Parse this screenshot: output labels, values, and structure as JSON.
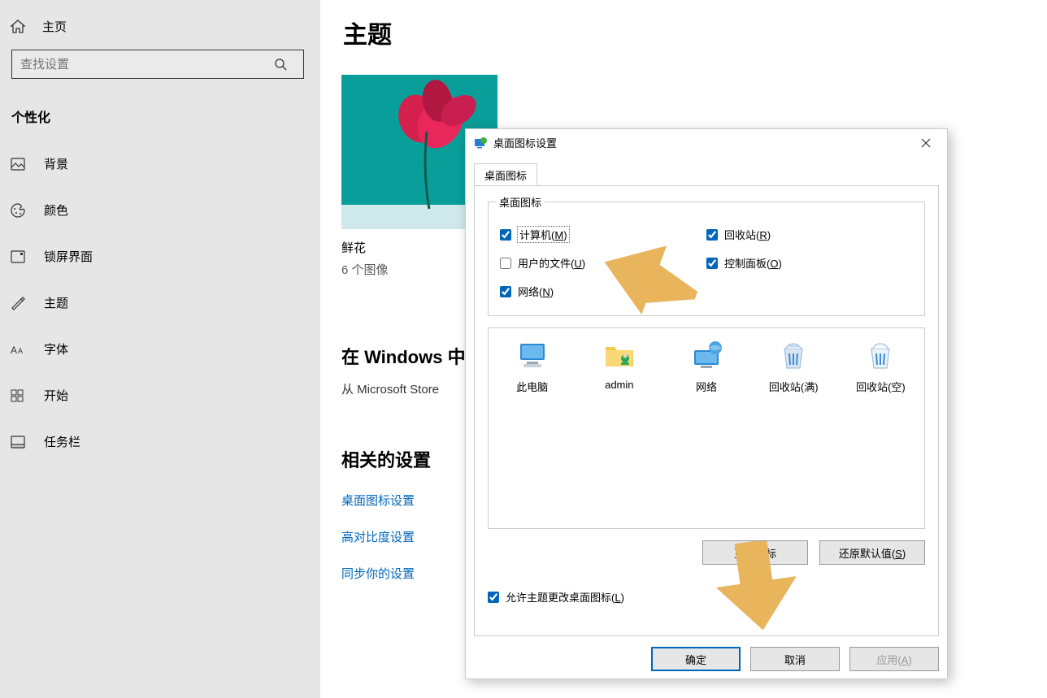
{
  "sidebar": {
    "home": "主页",
    "search_placeholder": "查找设置",
    "section": "个性化",
    "items": [
      {
        "label": "背景",
        "id": "background"
      },
      {
        "label": "颜色",
        "id": "colors"
      },
      {
        "label": "锁屏界面",
        "id": "lockscreen"
      },
      {
        "label": "主题",
        "id": "themes"
      },
      {
        "label": "字体",
        "id": "fonts"
      },
      {
        "label": "开始",
        "id": "start"
      },
      {
        "label": "任务栏",
        "id": "taskbar"
      }
    ]
  },
  "main": {
    "title": "主题",
    "theme_name": "鲜花",
    "theme_sub": "6 个图像",
    "store_head_prefix": "在 Windows 中",
    "store_sub_prefix": "从 Microsoft Store ",
    "related_head": "相关的设置",
    "links": [
      "桌面图标设置",
      "高对比度设置",
      "同步你的设置"
    ]
  },
  "dialog": {
    "title": "桌面图标设置",
    "tab": "桌面图标",
    "group_label": "桌面图标",
    "checks": {
      "computer": {
        "label": "计算机(",
        "shortcut": "M",
        "suffix": ")",
        "checked": true
      },
      "userfiles": {
        "label": "用户的文件(",
        "shortcut": "U",
        "suffix": ")",
        "checked": false
      },
      "network": {
        "label": "网络(",
        "shortcut": "N",
        "suffix": ")",
        "checked": true
      },
      "recycle": {
        "label": "回收站(",
        "shortcut": "R",
        "suffix": ")",
        "checked": true
      },
      "control": {
        "label": "控制面板(",
        "shortcut": "O",
        "suffix": ")",
        "checked": true
      }
    },
    "icons": [
      {
        "label": "此电脑",
        "kind": "pc"
      },
      {
        "label": "admin",
        "kind": "user"
      },
      {
        "label": "网络",
        "kind": "net"
      },
      {
        "label": "回收站(满)",
        "kind": "bin-full"
      },
      {
        "label": "回收站(空)",
        "kind": "bin-empty"
      }
    ],
    "btn_change": "更改图标",
    "btn_restore": {
      "label": "还原默认值(",
      "shortcut": "S",
      "suffix": ")"
    },
    "allow": {
      "label": "允许主题更改桌面图标(",
      "shortcut": "L",
      "suffix": ")",
      "checked": true
    },
    "ok": "确定",
    "cancel": "取消",
    "apply": {
      "label": "应用(",
      "shortcut": "A",
      "suffix": ")"
    }
  }
}
